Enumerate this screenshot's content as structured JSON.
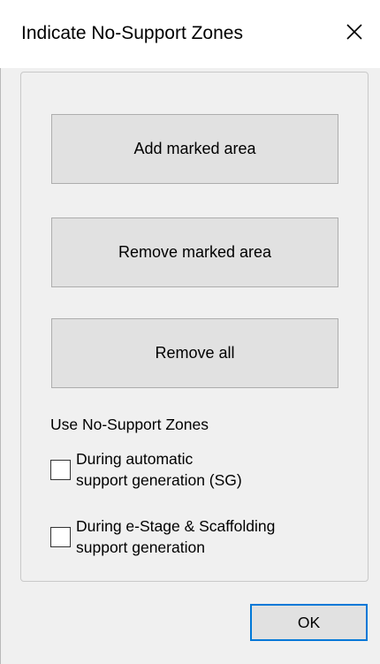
{
  "window": {
    "title": "Indicate No-Support Zones"
  },
  "actions": {
    "add_label": "Add marked area",
    "remove_label": "Remove marked area",
    "remove_all_label": "Remove all"
  },
  "options": {
    "section_label": "Use No-Support Zones",
    "items": [
      {
        "line1": "During automatic",
        "line2": "support generation (SG)",
        "checked": false
      },
      {
        "line1": "During e-Stage & Scaffolding",
        "line2": "support generation",
        "checked": false
      }
    ]
  },
  "footer": {
    "ok_label": "OK"
  },
  "colors": {
    "background": "#f0f0f0",
    "titlebar": "#ffffff",
    "button_face": "#e1e1e1",
    "button_border": "#adadad",
    "accent": "#0078d7"
  },
  "icons": {
    "close": "close-icon"
  }
}
